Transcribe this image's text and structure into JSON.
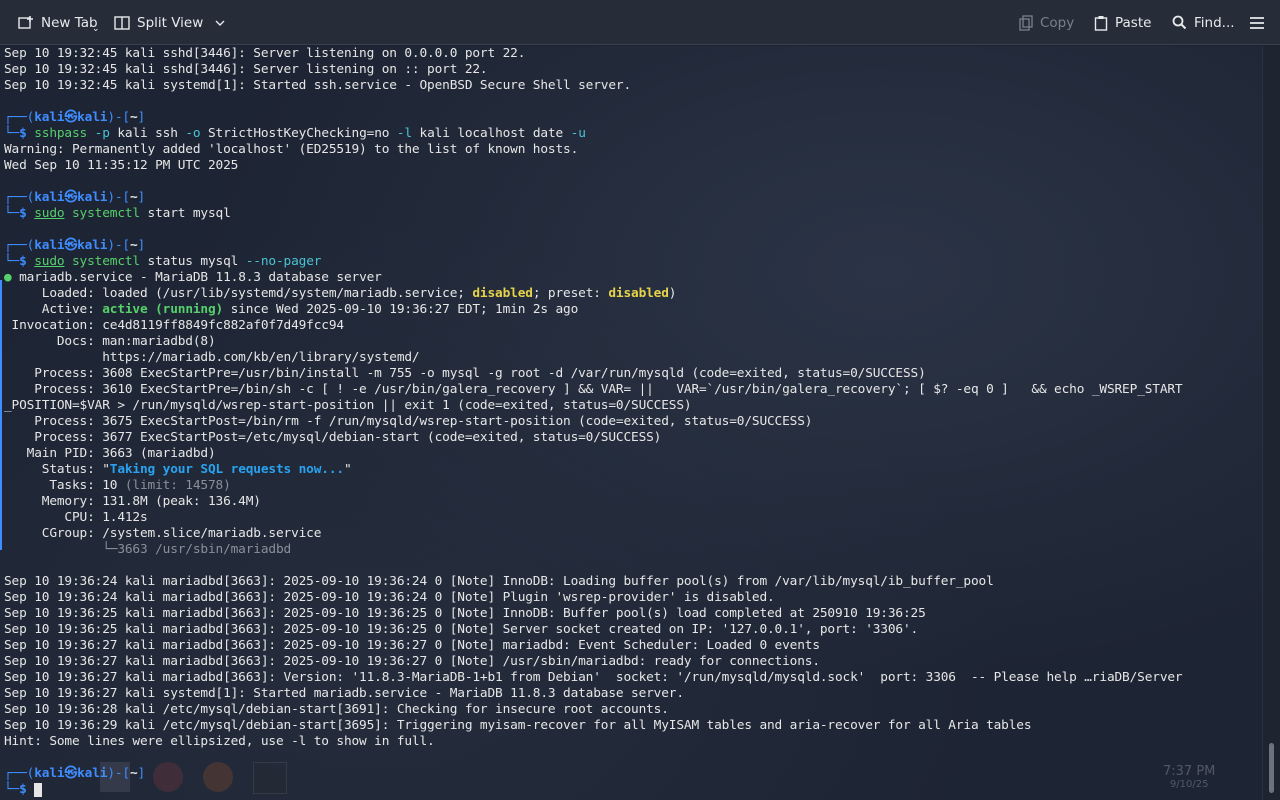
{
  "toolbar": {
    "new_tab": "New Tab",
    "split_view": "Split View",
    "copy": "Copy",
    "paste": "Paste",
    "find": "Find..."
  },
  "prompt": {
    "user": "kali",
    "host": "kali",
    "path": "~"
  },
  "lines": {
    "l1": "Sep 10 19:32:45 kali sshd[3446]: Server listening on 0.0.0.0 port 22.",
    "l2": "Sep 10 19:32:45 kali sshd[3446]: Server listening on :: port 22.",
    "l3": "Sep 10 19:32:45 kali systemd[1]: Started ssh.service - OpenBSD Secure Shell server.",
    "cmd1": [
      "sshpass",
      " -p",
      " kali ssh",
      " -o",
      " StrictHostKeyChecking=no",
      " -l",
      " kali localhost date",
      " -u"
    ],
    "warn": "Warning: Permanently added 'localhost' (ED25519) to the list of known hosts.",
    "date": "Wed Sep 10 11:35:12 PM UTC 2025",
    "cmd2": [
      "sudo",
      " systemctl",
      " start mysql"
    ],
    "cmd3": [
      "sudo",
      " systemctl",
      " status mysql",
      " --no-pager"
    ],
    "svc_title": " mariadb.service - MariaDB 11.8.3 database server",
    "loaded_a": "     Loaded: loaded (/usr/lib/systemd/system/mariadb.service; ",
    "loaded_b": "disabled",
    "loaded_c": "; preset: ",
    "loaded_d": "disabled",
    "loaded_e": ")",
    "active_a": "     Active: ",
    "active_b": "active (running)",
    "active_c": " since Wed 2025-09-10 19:36:27 EDT; 1min 2s ago",
    "invocation": " Invocation: ce4d8119ff8849fc882af0f7d49fcc94",
    "docs1": "       Docs: man:mariadbd(8)",
    "docs2": "             https://mariadb.com/kb/en/library/systemd/",
    "proc1": "    Process: 3608 ExecStartPre=/usr/bin/install -m 755 -o mysql -g root -d /var/run/mysqld (code=exited, status=0/SUCCESS)",
    "proc2": "    Process: 3610 ExecStartPre=/bin/sh -c [ ! -e /usr/bin/galera_recovery ] && VAR= ||   VAR=`/usr/bin/galera_recovery`; [ $? -eq 0 ]   && echo _WSREP_START",
    "proc2b": "_POSITION=$VAR > /run/mysqld/wsrep-start-position || exit 1 (code=exited, status=0/SUCCESS)",
    "proc3": "    Process: 3675 ExecStartPost=/bin/rm -f /run/mysqld/wsrep-start-position (code=exited, status=0/SUCCESS)",
    "proc4": "    Process: 3677 ExecStartPost=/etc/mysql/debian-start (code=exited, status=0/SUCCESS)",
    "mainpid": "   Main PID: 3663 (mariadbd)",
    "status_a": "     Status: \"",
    "status_b": "Taking your SQL requests now...",
    "status_c": "\"",
    "tasks_a": "      Tasks: 10 ",
    "tasks_b": "(limit: 14578)",
    "memory": "     Memory: 131.8M (peak: 136.4M)",
    "cpu": "        CPU: 1.412s",
    "cgroup": "     CGroup: /system.slice/mariadb.service",
    "cgroup2": "             └─3663 /usr/sbin/mariadbd",
    "j1": "Sep 10 19:36:24 kali mariadbd[3663]: 2025-09-10 19:36:24 0 [Note] InnoDB: Loading buffer pool(s) from /var/lib/mysql/ib_buffer_pool",
    "j2": "Sep 10 19:36:24 kali mariadbd[3663]: 2025-09-10 19:36:24 0 [Note] Plugin 'wsrep-provider' is disabled.",
    "j3": "Sep 10 19:36:25 kali mariadbd[3663]: 2025-09-10 19:36:25 0 [Note] InnoDB: Buffer pool(s) load completed at 250910 19:36:25",
    "j4": "Sep 10 19:36:25 kali mariadbd[3663]: 2025-09-10 19:36:25 0 [Note] Server socket created on IP: '127.0.0.1', port: '3306'.",
    "j5": "Sep 10 19:36:27 kali mariadbd[3663]: 2025-09-10 19:36:27 0 [Note] mariadbd: Event Scheduler: Loaded 0 events",
    "j6": "Sep 10 19:36:27 kali mariadbd[3663]: 2025-09-10 19:36:27 0 [Note] /usr/sbin/mariadbd: ready for connections.",
    "j7": "Sep 10 19:36:27 kali mariadbd[3663]: Version: '11.8.3-MariaDB-1+b1 from Debian'  socket: '/run/mysqld/mysqld.sock'  port: 3306  -- Please help …riaDB/Server",
    "j8": "Sep 10 19:36:27 kali systemd[1]: Started mariadb.service - MariaDB 11.8.3 database server.",
    "j9": "Sep 10 19:36:28 kali /etc/mysql/debian-start[3691]: Checking for insecure root accounts.",
    "j10": "Sep 10 19:36:29 kali /etc/mysql/debian-start[3695]: Triggering myisam-recover for all MyISAM tables and aria-recover for all Aria tables",
    "hint": "Hint: Some lines were ellipsized, use -l to show in full."
  },
  "taskbar": {
    "time": "7:37 PM",
    "date": "9/10/25"
  },
  "colors": {
    "prompt": "#3f8cff",
    "active": "#56d06b",
    "disabled": "#e6d34a",
    "status": "#29a3f0"
  }
}
